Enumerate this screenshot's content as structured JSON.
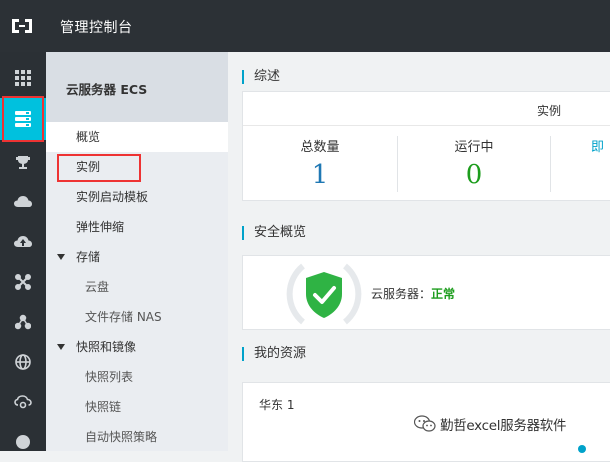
{
  "topbar": {
    "title": "管理控制台"
  },
  "iconbar": {
    "items": [
      "apps-grid-icon",
      "ecs-server-icon",
      "trophy-icon",
      "cloud-icon",
      "cloud-upload-icon",
      "network-icon",
      "cluster-icon",
      "globe-icon",
      "cloud-settings-icon",
      "circle-icon"
    ],
    "active_index": 1,
    "accent": "#00c1de"
  },
  "sidenav": {
    "title": "云服务器 ECS",
    "items": [
      {
        "label": "概览"
      },
      {
        "label": "实例"
      },
      {
        "label": "实例启动模板"
      },
      {
        "label": "弹性伸缩"
      },
      {
        "label": "存储"
      },
      {
        "label": "云盘"
      },
      {
        "label": "文件存储 NAS"
      },
      {
        "label": "快照和镜像"
      },
      {
        "label": "快照列表"
      },
      {
        "label": "快照链"
      },
      {
        "label": "自动快照策略"
      }
    ]
  },
  "overview": {
    "title": "综述",
    "header_label": "实例",
    "stats": [
      {
        "label": "总数量",
        "value": "1",
        "color": "#1f78b4"
      },
      {
        "label": "运行中",
        "value": "0",
        "color": "#1d9d1d"
      },
      {
        "label": "即",
        "value": "",
        "color": "#00a2ca"
      }
    ]
  },
  "security": {
    "title": "安全概览",
    "label": "云服务器：",
    "status": "正常",
    "status_color": "#1d9d1d"
  },
  "resources": {
    "title": "我的资源",
    "region": "华东 1"
  },
  "watermark": {
    "text": "勤哲excel服务器软件"
  }
}
